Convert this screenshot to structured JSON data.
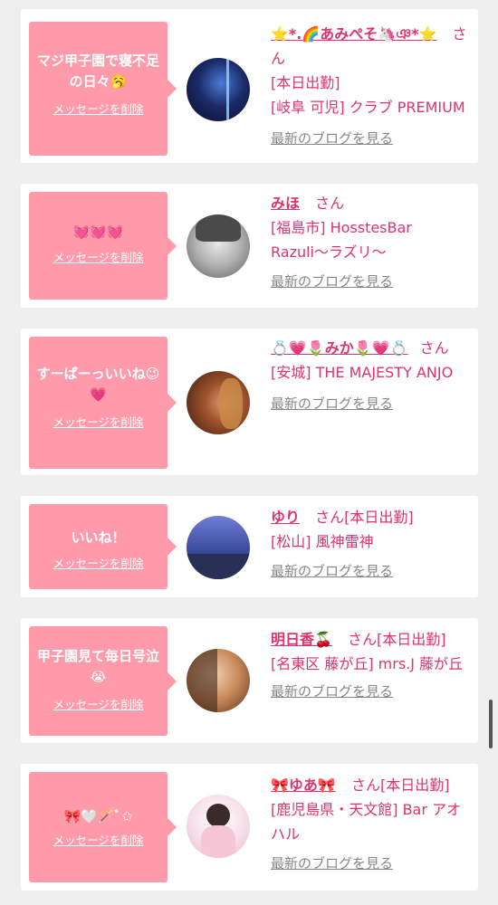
{
  "delete_label": "メッセージを削除",
  "blog_label": "最新のブログを見る",
  "san_label": "さん",
  "cards": [
    {
      "message": "マジ甲子園で寝不足の日々🥱",
      "name": "⭐️*.🌈あみぺそ🦄ঞ*⭐️",
      "status": "[本日出勤]",
      "shop": "[岐阜 可児] クラブ PREMIUM"
    },
    {
      "message": "💓💓💓",
      "name": "みほ",
      "status": "",
      "shop": "[福島市] HosstesBar Razuli〜ラズリ〜"
    },
    {
      "message": "すーぱーっいいね😉💗",
      "name": "💍💗🌷みか🌷💗💍",
      "status": "",
      "shop": "[安城] THE MAJESTY ANJO"
    },
    {
      "message": "いいね！",
      "name": "ゆり",
      "status": "[本日出勤]",
      "shop": "[松山] 風神雷神"
    },
    {
      "message": "甲子園見て毎日号泣😭",
      "name": "明日香🍒",
      "status": "[本日出勤]",
      "shop": "[名東区 藤が丘] mrs.J 藤が丘"
    },
    {
      "message": "🎀🤍🪄ﾞ✩",
      "name": "🎀ゆあ🎀",
      "status": "[本日出勤]",
      "shop": "[鹿児島県・天文館] Bar アオハル"
    }
  ],
  "colors": {
    "accent": "#e0336b",
    "bubble": "#ff9aaa",
    "background": "#efefef"
  }
}
